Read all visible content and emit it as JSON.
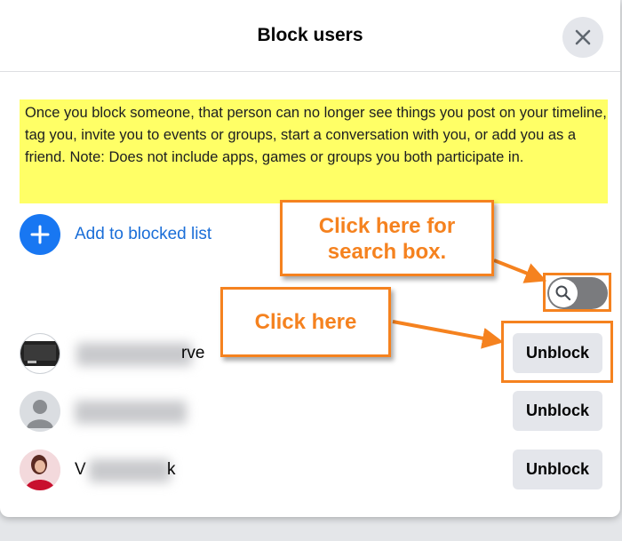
{
  "dialog": {
    "title": "Block users",
    "close_icon": "close-icon"
  },
  "notice": {
    "text": "Once you block someone, that person can no longer see things you post on your timeline, tag you, invite you to events or groups, start a conversation with you, or add you as a friend. Note: Does not include apps, games or groups you both participate in."
  },
  "add_blocked": {
    "label": "Add to blocked list",
    "icon": "plus-icon"
  },
  "annotations": {
    "search_callout": "Click here for search box.",
    "unblock_callout": "Click here"
  },
  "search_toggle": {
    "icon": "search-icon"
  },
  "blocked_users": [
    {
      "visible_name": "rve",
      "button": "Unblock"
    },
    {
      "visible_name": "",
      "button": "Unblock"
    },
    {
      "visible_name_start": "V",
      "visible_name_end": "k",
      "button": "Unblock"
    }
  ],
  "colors": {
    "accent_blue": "#1877f2",
    "link_blue": "#1a6ed8",
    "highlight_yellow": "#ffff66",
    "annotation_orange": "#f5821f",
    "button_gray": "#e4e6eb"
  }
}
